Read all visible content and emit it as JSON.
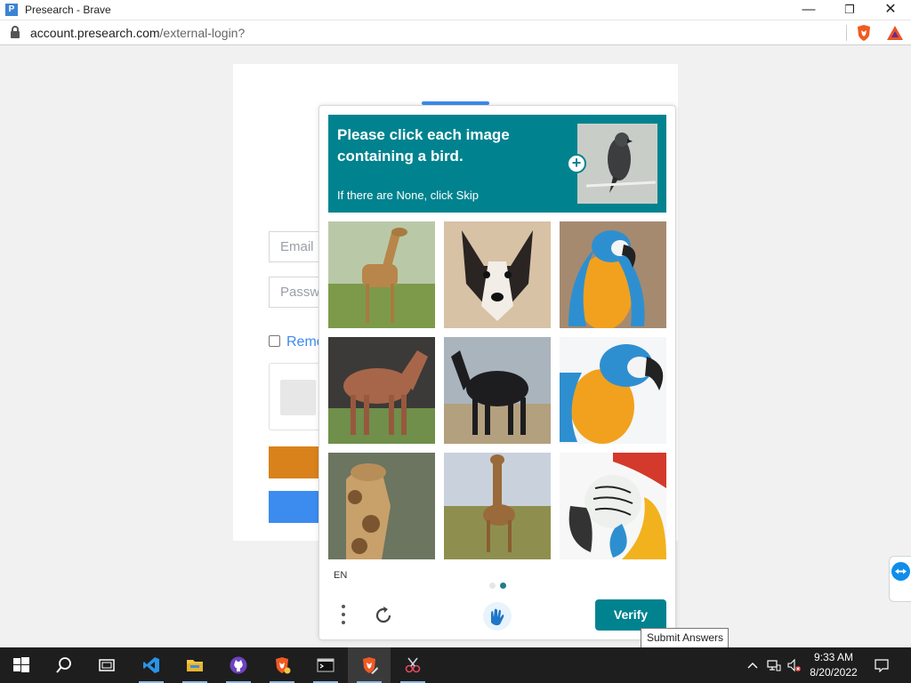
{
  "window": {
    "title": "Presearch - Brave",
    "app_icon_letter": "P",
    "minimize": "—",
    "maximize": "❐",
    "close": "✕"
  },
  "address_bar": {
    "url_domain": "account.presearch.com",
    "url_path": "/external-login?"
  },
  "login_form": {
    "email_placeholder": "Email",
    "password_placeholder": "Passw",
    "remember_label": "Remo"
  },
  "captcha": {
    "prompt": "Please click each image containing a bird.",
    "sub_prompt": "If there are None, click Skip",
    "example_icon": "plus-icon",
    "tiles": [
      {
        "subject": "giraffe"
      },
      {
        "subject": "dog"
      },
      {
        "subject": "parrot"
      },
      {
        "subject": "horse"
      },
      {
        "subject": "horse"
      },
      {
        "subject": "parrot"
      },
      {
        "subject": "giraffe"
      },
      {
        "subject": "giraffe"
      },
      {
        "subject": "parrot"
      }
    ],
    "language": "EN",
    "pages_total": 2,
    "current_page": 2,
    "verify_label": "Verify",
    "tooltip": "Submit Answers",
    "accent_color": "#00838f"
  },
  "taskbar": {
    "apps": [
      "start",
      "search",
      "task-view",
      "vscode",
      "file-explorer",
      "github-desktop",
      "brave",
      "terminal",
      "brave-active",
      "snipping-tool"
    ],
    "time": "9:33 AM",
    "date": "8/20/2022"
  }
}
